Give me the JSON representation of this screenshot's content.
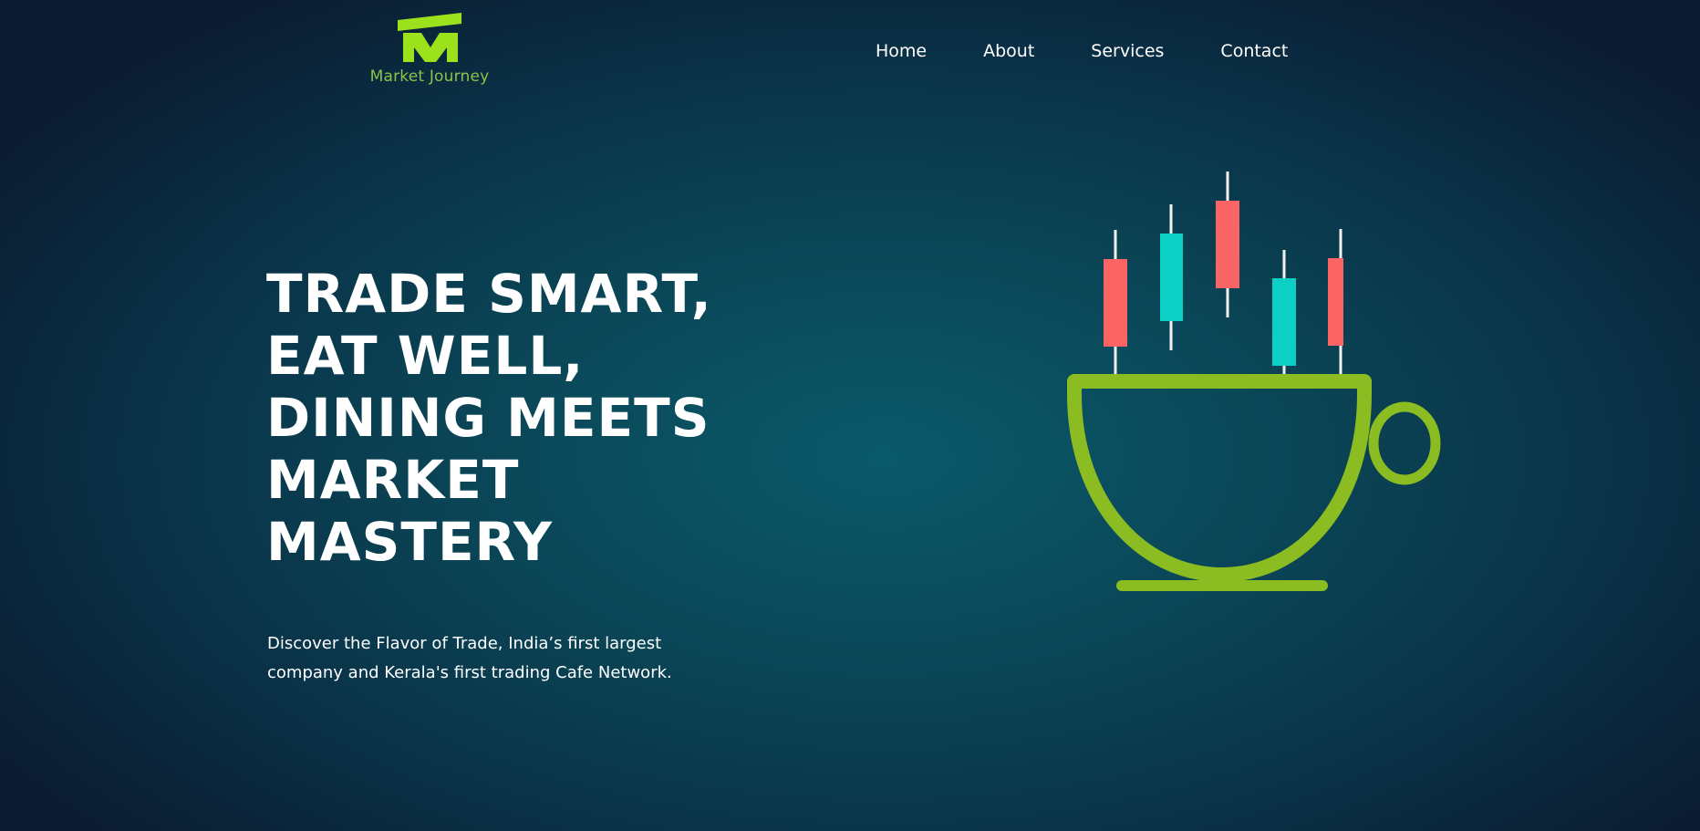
{
  "brand": {
    "name": "Market Journey",
    "logo_icon": "market-journey-m-icon",
    "color": "#8bc34a"
  },
  "nav": {
    "items": [
      {
        "label": "Home"
      },
      {
        "label": "About"
      },
      {
        "label": "Services"
      },
      {
        "label": "Contact"
      }
    ]
  },
  "hero": {
    "title_lines": [
      "TRADE SMART,",
      "EAT WELL,",
      "DINING MEETS",
      "MARKET",
      "MASTERY"
    ],
    "subtitle_lines": [
      "Discover the Flavor of Trade, India’s first largest",
      "company and Kerala's first trading Cafe Network."
    ],
    "illustration": {
      "icon": "candlestick-coffee-cup-icon",
      "cup_color": "#8bbd22",
      "bear_color": "#fa6464",
      "bull_color": "#0cd0c4"
    }
  },
  "colors": {
    "accent": "#8bc34a",
    "background_center": "#0a5a6a",
    "background_edge": "#0b1c30"
  }
}
